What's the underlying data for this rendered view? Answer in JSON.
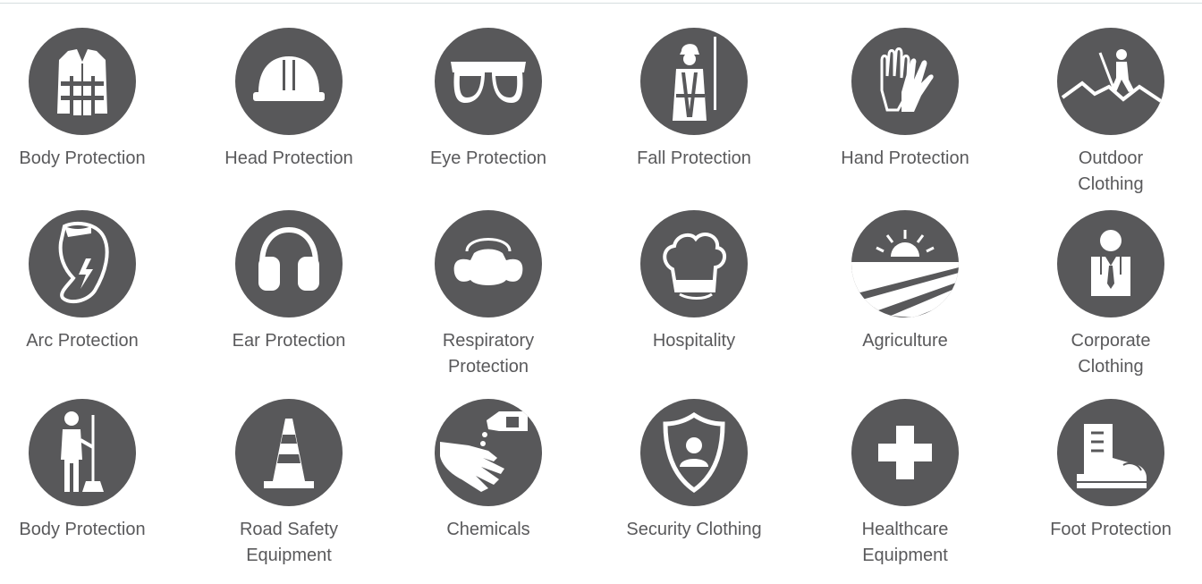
{
  "categories": [
    {
      "lines": [
        "Body Protection"
      ],
      "icon": "vest-icon"
    },
    {
      "lines": [
        "Head Protection"
      ],
      "icon": "hard-hat-icon"
    },
    {
      "lines": [
        "Eye Protection"
      ],
      "icon": "goggles-icon"
    },
    {
      "lines": [
        "Fall Protection"
      ],
      "icon": "harness-worker-icon"
    },
    {
      "lines": [
        "Hand Protection"
      ],
      "icon": "gloves-icon"
    },
    {
      "lines": [
        "Outdoor",
        "Clothing"
      ],
      "icon": "hiker-icon"
    },
    {
      "lines": [
        "Arc Protection"
      ],
      "icon": "arc-flash-suit-icon"
    },
    {
      "lines": [
        "Ear Protection"
      ],
      "icon": "ear-muffs-icon"
    },
    {
      "lines": [
        "Respiratory",
        "Protection"
      ],
      "icon": "respirator-mask-icon"
    },
    {
      "lines": [
        "Hospitality"
      ],
      "icon": "chef-hat-icon"
    },
    {
      "lines": [
        "Agriculture"
      ],
      "icon": "sun-field-icon"
    },
    {
      "lines": [
        "Corporate",
        "Clothing"
      ],
      "icon": "suit-tie-icon"
    },
    {
      "lines": [
        "Body Protection"
      ],
      "icon": "cleaner-with-mop-icon"
    },
    {
      "lines": [
        "Road Safety",
        "Equipment"
      ],
      "icon": "traffic-cone-icon"
    },
    {
      "lines": [
        "Chemicals"
      ],
      "icon": "chemical-hand-icon"
    },
    {
      "lines": [
        "Security Clothing"
      ],
      "icon": "security-shield-icon"
    },
    {
      "lines": [
        "Healthcare",
        "Equipment"
      ],
      "icon": "medical-cross-icon"
    },
    {
      "lines": [
        "Foot Protection"
      ],
      "icon": "safety-boot-icon"
    }
  ],
  "colors": {
    "circle": "#58585a",
    "icon": "#ffffff",
    "label": "#59595b",
    "rule": "#d6dedf"
  }
}
